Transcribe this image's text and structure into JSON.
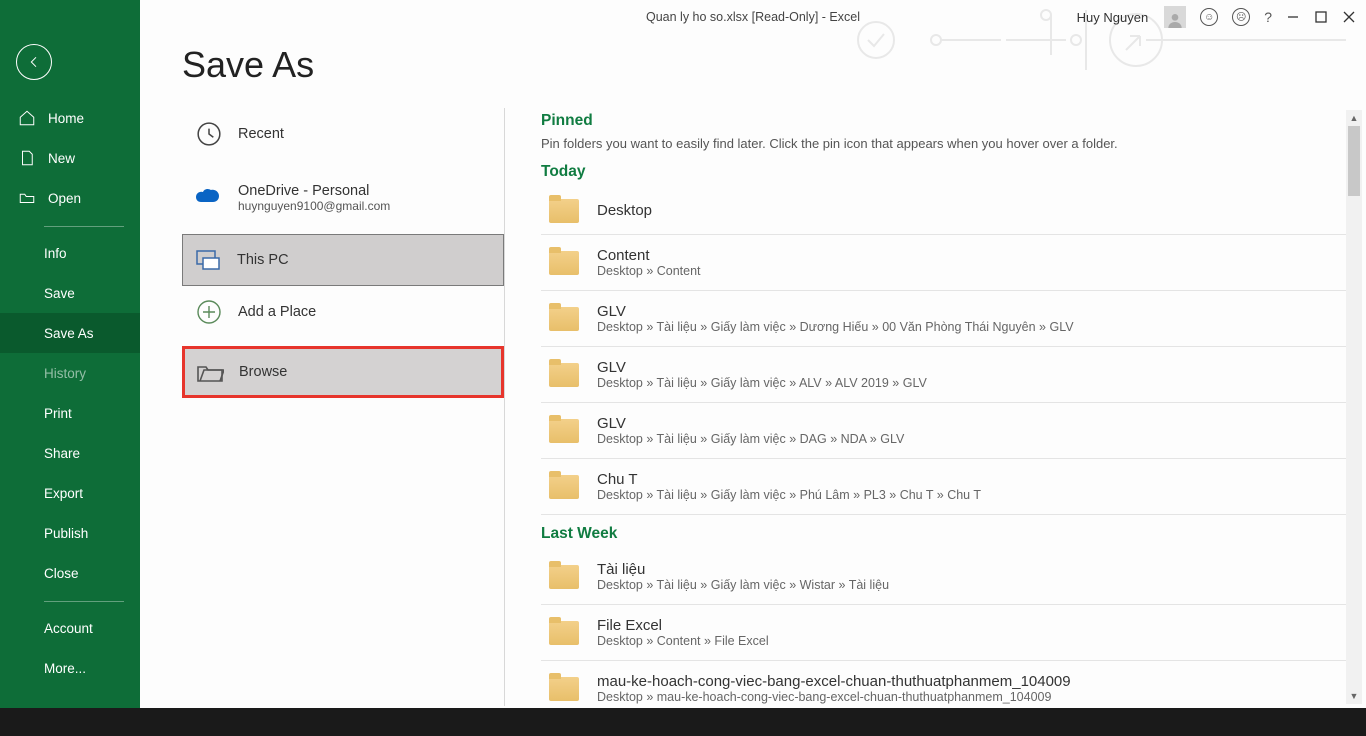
{
  "titlebar": {
    "filename": "Quan ly ho so.xlsx",
    "readonly": "[Read-Only]",
    "appname": "Excel",
    "fulltext": "Quan ly ho so.xlsx  [Read-Only]  -  Excel",
    "user": "Huy Nguyen",
    "help": "?"
  },
  "page": {
    "title": "Save As"
  },
  "sidebar": {
    "home": "Home",
    "new": "New",
    "open": "Open",
    "info": "Info",
    "save": "Save",
    "saveas": "Save As",
    "history": "History",
    "print": "Print",
    "share": "Share",
    "export": "Export",
    "publish": "Publish",
    "close": "Close",
    "account": "Account",
    "more": "More..."
  },
  "locations": {
    "recent": "Recent",
    "onedrive": "OneDrive - Personal",
    "onedrive_email": "huynguyen9100@gmail.com",
    "thispc": "This PC",
    "addplace": "Add a Place",
    "browse": "Browse"
  },
  "sections": {
    "pinned": "Pinned",
    "pinned_hint": "Pin folders you want to easily find later. Click the pin icon that appears when you hover over a folder.",
    "today": "Today",
    "lastweek": "Last Week"
  },
  "folders_today": [
    {
      "name": "Desktop",
      "path": ""
    },
    {
      "name": "Content",
      "path": "Desktop » Content"
    },
    {
      "name": "GLV",
      "path": "Desktop » Tài liệu » Giấy làm việc » Dương Hiếu » 00 Văn Phòng Thái Nguyên » GLV"
    },
    {
      "name": "GLV",
      "path": "Desktop » Tài liệu » Giấy làm việc » ALV » ALV 2019 » GLV"
    },
    {
      "name": "GLV",
      "path": "Desktop » Tài liệu » Giấy làm việc » DAG » NDA » GLV"
    },
    {
      "name": "Chu T",
      "path": "Desktop » Tài liệu » Giấy làm việc » Phú Lâm » PL3 » Chu T » Chu T"
    }
  ],
  "folders_lastweek": [
    {
      "name": "Tài liệu",
      "path": "Desktop » Tài liệu » Giấy làm việc » Wistar » Tài liệu"
    },
    {
      "name": "File Excel",
      "path": "Desktop » Content » File Excel"
    },
    {
      "name": "mau-ke-hoach-cong-viec-bang-excel-chuan-thuthuatphanmem_104009",
      "path": "Desktop » mau-ke-hoach-cong-viec-bang-excel-chuan-thuthuatphanmem_104009"
    }
  ]
}
